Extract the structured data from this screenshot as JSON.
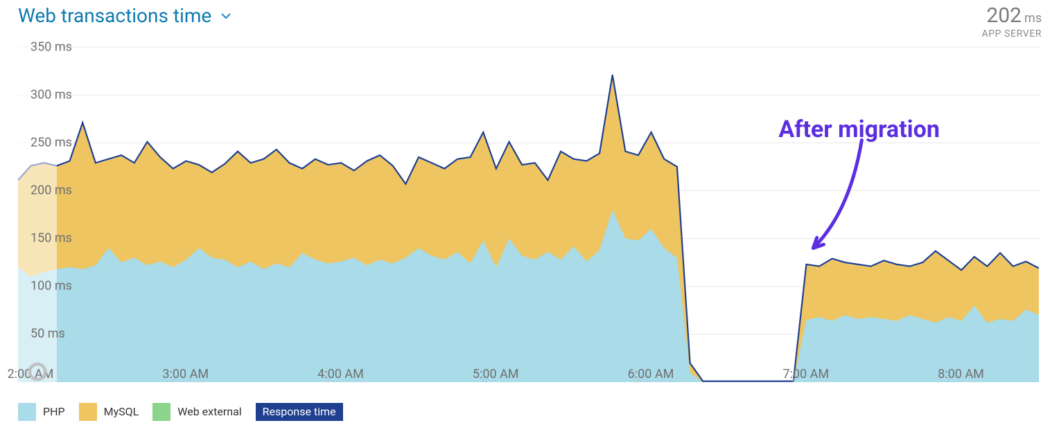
{
  "header": {
    "title": "Web transactions time",
    "metric_value": "202",
    "metric_unit": "ms",
    "metric_sub": "APP SERVER"
  },
  "annotation": {
    "text": "After migration",
    "color": "#5b2ee0"
  },
  "legend": [
    {
      "label": "PHP",
      "color": "#a9dbe8"
    },
    {
      "label": "MySQL",
      "color": "#eec560"
    },
    {
      "label": "Web external",
      "color": "#8cd48c"
    },
    {
      "label": "Response time",
      "bg": "#1f3f8f",
      "fg": "#ffffff"
    }
  ],
  "chart_data": {
    "type": "area",
    "title": "Web transactions time",
    "xlabel": "",
    "ylabel": "",
    "y_unit": "ms",
    "ylim": [
      0,
      355
    ],
    "y_ticks": [
      50,
      100,
      150,
      200,
      250,
      300,
      350
    ],
    "x_tick_labels": [
      "2:00 AM",
      "3:00 AM",
      "4:00 AM",
      "5:00 AM",
      "6:00 AM",
      "7:00 AM",
      "8:00 AM"
    ],
    "x_tick_indices": [
      0,
      12,
      24,
      36,
      48,
      60,
      72
    ],
    "n_points": 80,
    "series": [
      {
        "name": "PHP",
        "color": "#a9dbe8",
        "values": [
          120,
          110,
          115,
          118,
          120,
          118,
          122,
          140,
          125,
          130,
          122,
          126,
          120,
          128,
          140,
          130,
          128,
          120,
          126,
          118,
          124,
          120,
          135,
          128,
          124,
          126,
          130,
          122,
          128,
          124,
          130,
          140,
          132,
          128,
          136,
          124,
          148,
          120,
          150,
          132,
          128,
          136,
          128,
          142,
          126,
          138,
          180,
          150,
          148,
          160,
          140,
          130,
          10,
          0,
          0,
          0,
          0,
          0,
          0,
          0,
          0,
          65,
          68,
          64,
          70,
          66,
          68,
          66,
          64,
          70,
          66,
          62,
          68,
          64,
          80,
          62,
          66,
          64,
          76,
          70
        ]
      },
      {
        "name": "MySQL",
        "color": "#eec560",
        "values": [
          210,
          225,
          228,
          225,
          230,
          270,
          228,
          232,
          236,
          228,
          250,
          234,
          222,
          230,
          226,
          218,
          227,
          240,
          228,
          232,
          242,
          228,
          222,
          232,
          226,
          228,
          220,
          230,
          236,
          225,
          206,
          234,
          228,
          222,
          232,
          234,
          260,
          222,
          250,
          226,
          228,
          210,
          240,
          232,
          230,
          238,
          320,
          240,
          236,
          260,
          232,
          224,
          20,
          0,
          0,
          0,
          0,
          0,
          0,
          0,
          0,
          122,
          120,
          128,
          124,
          122,
          120,
          126,
          122,
          120,
          124,
          136,
          126,
          116,
          130,
          120,
          134,
          120,
          125,
          118
        ]
      },
      {
        "name": "Web external",
        "color": "#8cd48c",
        "values": [
          210,
          225,
          228,
          225,
          230,
          270,
          228,
          232,
          236,
          228,
          250,
          234,
          222,
          230,
          226,
          218,
          227,
          240,
          228,
          232,
          242,
          228,
          222,
          232,
          226,
          228,
          220,
          230,
          236,
          225,
          206,
          234,
          228,
          222,
          232,
          234,
          260,
          222,
          250,
          226,
          228,
          210,
          240,
          232,
          230,
          238,
          320,
          240,
          236,
          260,
          232,
          224,
          20,
          0,
          0,
          0,
          0,
          0,
          0,
          0,
          0,
          122,
          120,
          128,
          124,
          122,
          120,
          126,
          122,
          120,
          124,
          136,
          126,
          116,
          130,
          120,
          134,
          120,
          125,
          118
        ]
      }
    ],
    "response_time_line": {
      "name": "Response time",
      "color": "#1f3f8f",
      "values": [
        211,
        226,
        229,
        226,
        231,
        271,
        229,
        233,
        237,
        229,
        251,
        235,
        223,
        231,
        227,
        219,
        228,
        241,
        229,
        233,
        243,
        229,
        223,
        233,
        227,
        229,
        221,
        231,
        237,
        226,
        207,
        235,
        229,
        223,
        233,
        235,
        261,
        223,
        251,
        227,
        229,
        211,
        241,
        233,
        231,
        239,
        321,
        241,
        237,
        261,
        233,
        225,
        20,
        1,
        1,
        1,
        1,
        1,
        1,
        1,
        1,
        123,
        121,
        129,
        125,
        123,
        121,
        127,
        123,
        121,
        125,
        137,
        127,
        117,
        131,
        121,
        135,
        121,
        126,
        119
      ]
    },
    "faded_until_index": 3,
    "annotation_target_index": 61
  }
}
